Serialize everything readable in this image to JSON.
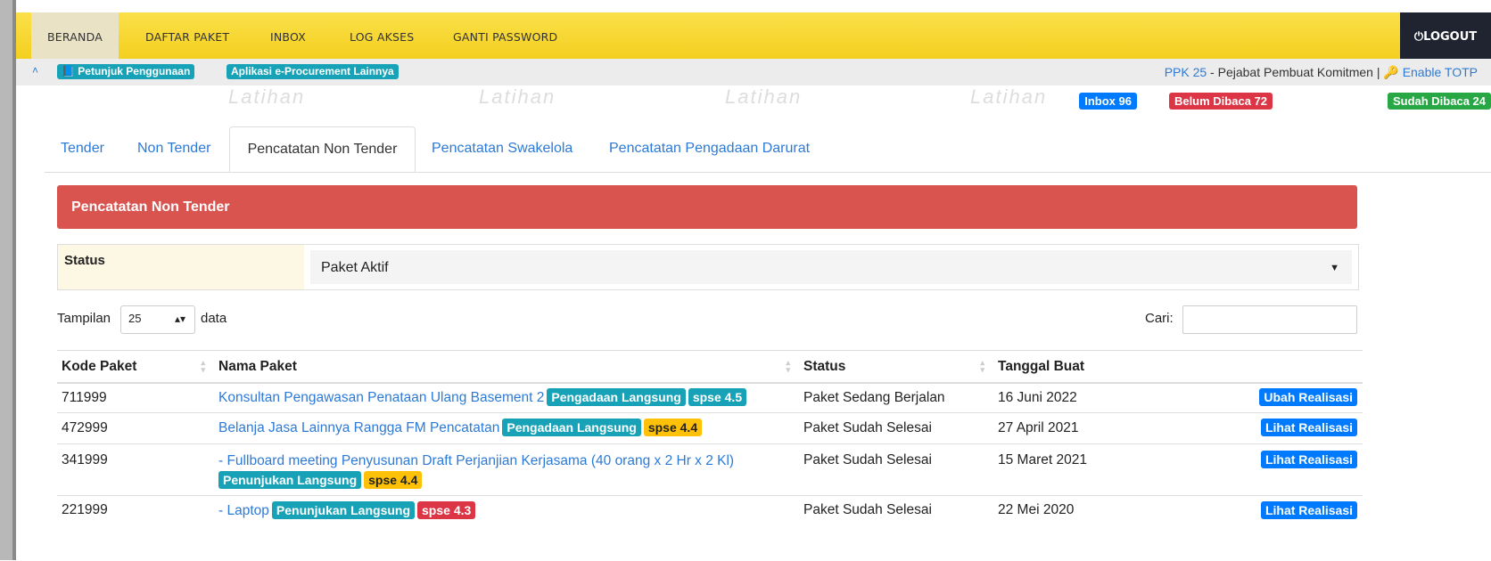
{
  "nav": {
    "items": [
      "BERANDA",
      "DAFTAR PAKET",
      "INBOX",
      "LOG AKSES",
      "GANTI PASSWORD"
    ],
    "logout": "LOGOUT",
    "logout_icon": "power-icon"
  },
  "subbar": {
    "petunjuk": "Petunjuk Penggunaan",
    "aplikasi": "Aplikasi e-Procurement Lainnya",
    "ppk_link": "PPK 25",
    "ppk_text": " - Pejabat Pembuat Komitmen | ",
    "totp": "Enable TOTP"
  },
  "counts": {
    "inbox": "Inbox 96",
    "belum": "Belum Dibaca 72",
    "sudah": "Sudah Dibaca 24"
  },
  "watermark": "Latihan",
  "tabs": [
    "Tender",
    "Non Tender",
    "Pencatatan Non Tender",
    "Pencatatan Swakelola",
    "Pencatatan Pengadaan Darurat"
  ],
  "panel_title": "Pencatatan Non Tender",
  "filter": {
    "label": "Status",
    "value": "Paket Aktif"
  },
  "tampilan": {
    "prefix": "Tampilan",
    "value": "25",
    "suffix": "data"
  },
  "search": {
    "label": "Cari:"
  },
  "table": {
    "headers": [
      "Kode Paket",
      "Nama Paket",
      "Status",
      "Tanggal Buat"
    ],
    "rows": [
      {
        "kode": "711999",
        "nama": "Konsultan Pengawasan Penataan Ulang Basement 2",
        "metode": "Pengadaan Langsung",
        "spse": "spse 4.5",
        "status": "Paket Sedang Berjalan",
        "tanggal": "16 Juni 2022",
        "aksi": "Ubah Realisasi"
      },
      {
        "kode": "472999",
        "nama": "Belanja Jasa Lainnya Rangga FM Pencatatan",
        "metode": "Pengadaan Langsung",
        "spse": "spse 4.4",
        "status": "Paket Sudah Selesai",
        "tanggal": "27 April 2021",
        "aksi": "Lihat Realisasi"
      },
      {
        "kode": "341999",
        "nama": "- Fullboard meeting Penyusunan Draft Perjanjian Kerjasama (40 orang x 2 Hr x 2 Kl)",
        "metode": "Penunjukan Langsung",
        "spse": "spse 4.4",
        "status": "Paket Sudah Selesai",
        "tanggal": "15 Maret 2021",
        "aksi": "Lihat Realisasi"
      },
      {
        "kode": "221999",
        "nama": "- Laptop",
        "metode": "Penunjukan Langsung",
        "spse": "spse 4.3",
        "status": "Paket Sudah Selesai",
        "tanggal": "22 Mei 2020",
        "aksi": "Lihat Realisasi"
      }
    ]
  }
}
